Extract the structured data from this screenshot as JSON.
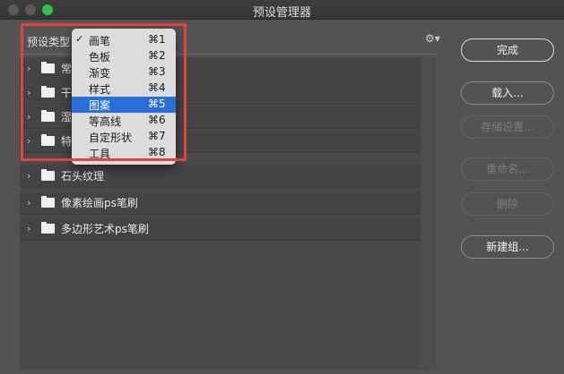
{
  "window": {
    "title": "预设管理器"
  },
  "preset_type_label": "预设类型",
  "dropdown": {
    "items": [
      {
        "label": "画笔",
        "shortcut": "⌘1",
        "checked": true
      },
      {
        "label": "色板",
        "shortcut": "⌘2"
      },
      {
        "label": "渐变",
        "shortcut": "⌘3"
      },
      {
        "label": "样式",
        "shortcut": "⌘4"
      },
      {
        "label": "图案",
        "shortcut": "⌘5",
        "selected": true
      },
      {
        "label": "等高线",
        "shortcut": "⌘6"
      },
      {
        "label": "自定形状",
        "shortcut": "⌘7"
      },
      {
        "label": "工具",
        "shortcut": "⌘8"
      }
    ]
  },
  "list": {
    "rows": [
      {
        "label": "常规画笔"
      },
      {
        "label": "干介质画笔"
      },
      {
        "label": "湿介质画笔"
      },
      {
        "label": "特殊效果画笔"
      },
      {
        "label": "石头纹理"
      },
      {
        "label": "像素绘画ps笔刷"
      },
      {
        "label": "多边形艺术ps笔刷"
      }
    ]
  },
  "buttons": {
    "done": "完成",
    "load": "载入...",
    "save_set": "存储设置...",
    "rename": "重命名...",
    "delete": "删除",
    "new_group": "新建组..."
  },
  "icons": {
    "gear": "gear-icon",
    "folder": "folder-icon",
    "chevron": "chevron-right-icon",
    "check": "checkmark-icon"
  },
  "colors": {
    "highlight_border": "#e0453b",
    "selection": "#2a6fd6",
    "maximize": "#2ec441"
  }
}
